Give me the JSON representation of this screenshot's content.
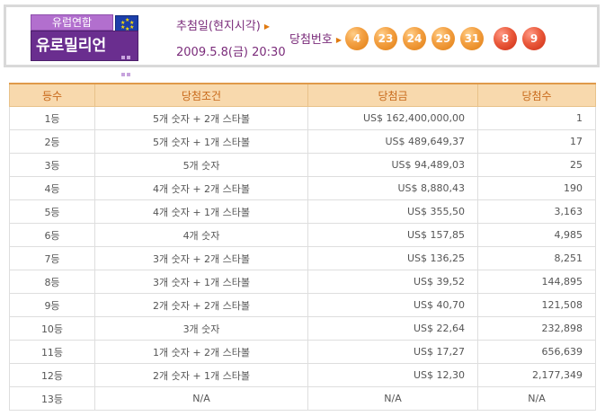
{
  "logo": {
    "top_text": "유럽연합",
    "bottom_text": "유로밀리언"
  },
  "draw": {
    "date_label": "추첨일(현지시각)",
    "date_value": "2009.5.8(금) 20:30",
    "numbers_label": "당첨번호",
    "main_numbers": [
      "4",
      "23",
      "24",
      "29",
      "31"
    ],
    "star_numbers": [
      "8",
      "9"
    ]
  },
  "colors": {
    "main_ball": "#f0922e",
    "star_ball": "#e04a2c",
    "header_fill": "#f8d9ad",
    "header_text": "#c86a1b",
    "label_text": "#7a2b7a",
    "logo_purple": "#6a2e8f"
  },
  "table": {
    "headers": [
      "등수",
      "당첨조건",
      "당첨금",
      "당첨수"
    ],
    "rows": [
      {
        "rank": "1등",
        "condition": "5개 숫자 + 2개 스타볼",
        "prize": "US$ 162,400,000,00",
        "winners": "1"
      },
      {
        "rank": "2등",
        "condition": "5개 숫자 + 1개 스타볼",
        "prize": "US$ 489,649,37",
        "winners": "17"
      },
      {
        "rank": "3등",
        "condition": "5개 숫자",
        "prize": "US$ 94,489,03",
        "winners": "25"
      },
      {
        "rank": "4등",
        "condition": "4개 숫자 + 2개 스타볼",
        "prize": "US$ 8,880,43",
        "winners": "190"
      },
      {
        "rank": "5등",
        "condition": "4개 숫자 + 1개 스타볼",
        "prize": "US$ 355,50",
        "winners": "3,163"
      },
      {
        "rank": "6등",
        "condition": "4개 숫자",
        "prize": "US$ 157,85",
        "winners": "4,985"
      },
      {
        "rank": "7등",
        "condition": "3개 숫자 + 2개 스타볼",
        "prize": "US$ 136,25",
        "winners": "8,251"
      },
      {
        "rank": "8등",
        "condition": "3개 숫자 + 1개 스타볼",
        "prize": "US$ 39,52",
        "winners": "144,895"
      },
      {
        "rank": "9등",
        "condition": "2개 숫자 + 2개 스타볼",
        "prize": "US$ 40,70",
        "winners": "121,508"
      },
      {
        "rank": "10등",
        "condition": "3개 숫자",
        "prize": "US$ 22,64",
        "winners": "232,898"
      },
      {
        "rank": "11등",
        "condition": "1개 숫자 + 2개 스타볼",
        "prize": "US$ 17,27",
        "winners": "656,639"
      },
      {
        "rank": "12등",
        "condition": "2개 숫자 + 1개 스타볼",
        "prize": "US$ 12,30",
        "winners": "2,177,349"
      },
      {
        "rank": "13등",
        "condition": "N/A",
        "prize": "N/A",
        "winners": "N/A",
        "na": true
      }
    ]
  }
}
